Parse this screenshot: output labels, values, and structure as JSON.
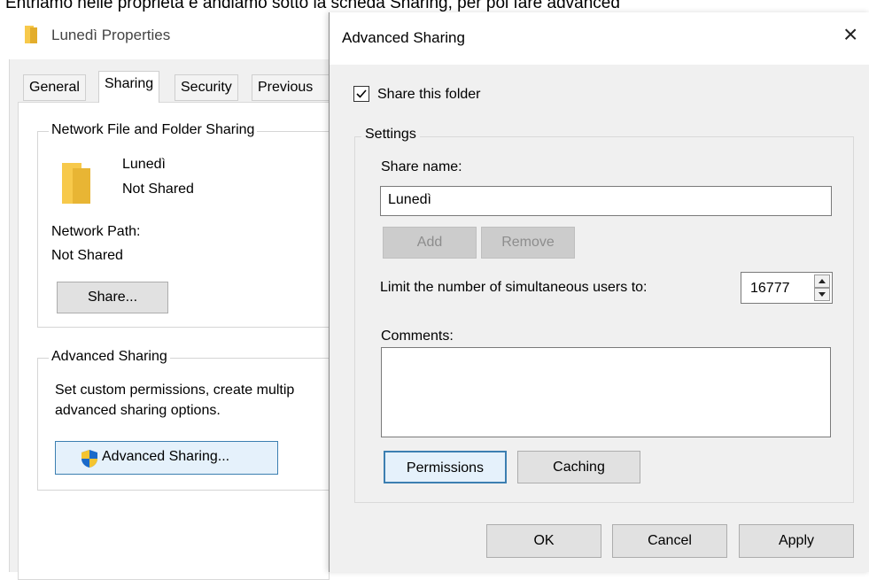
{
  "page_caption": "Entriamo nelle proprietà e andiamo sotto la scheda Sharing, per poi fare advanced",
  "properties_window": {
    "title": "Lunedì Properties",
    "tabs": [
      "General",
      "Sharing",
      "Security",
      "Previous"
    ],
    "active_tab": "Sharing",
    "network_group": {
      "legend": "Network File and Folder Sharing",
      "folder_name": "Lunedì",
      "share_status": "Not Shared",
      "network_path_label": "Network Path:",
      "network_path_value": "Not Shared",
      "share_button": "Share..."
    },
    "advanced_group": {
      "legend": "Advanced Sharing",
      "description_line1": "Set custom permissions, create multip",
      "description_line2": "advanced sharing options.",
      "button": "Advanced Sharing..."
    }
  },
  "advanced_dialog": {
    "title": "Advanced Sharing",
    "close": "×",
    "share_checkbox_label": "Share this folder",
    "share_checked": true,
    "settings_legend": "Settings",
    "share_name_label": "Share name:",
    "share_name_value": "Lunedì",
    "add_button": "Add",
    "remove_button": "Remove",
    "limit_label": "Limit the number of simultaneous users to:",
    "limit_value": "16777",
    "comments_label": "Comments:",
    "comments_value": "",
    "permissions_button": "Permissions",
    "caching_button": "Caching",
    "ok_button": "OK",
    "cancel_button": "Cancel",
    "apply_button": "Apply"
  },
  "colors": {
    "folder": "#f7c94b",
    "shield_blue": "#1b6ac9",
    "shield_yellow": "#f4c430",
    "focus_border": "#3c7fb1",
    "selected_button_bg": "#e5f1fb"
  }
}
